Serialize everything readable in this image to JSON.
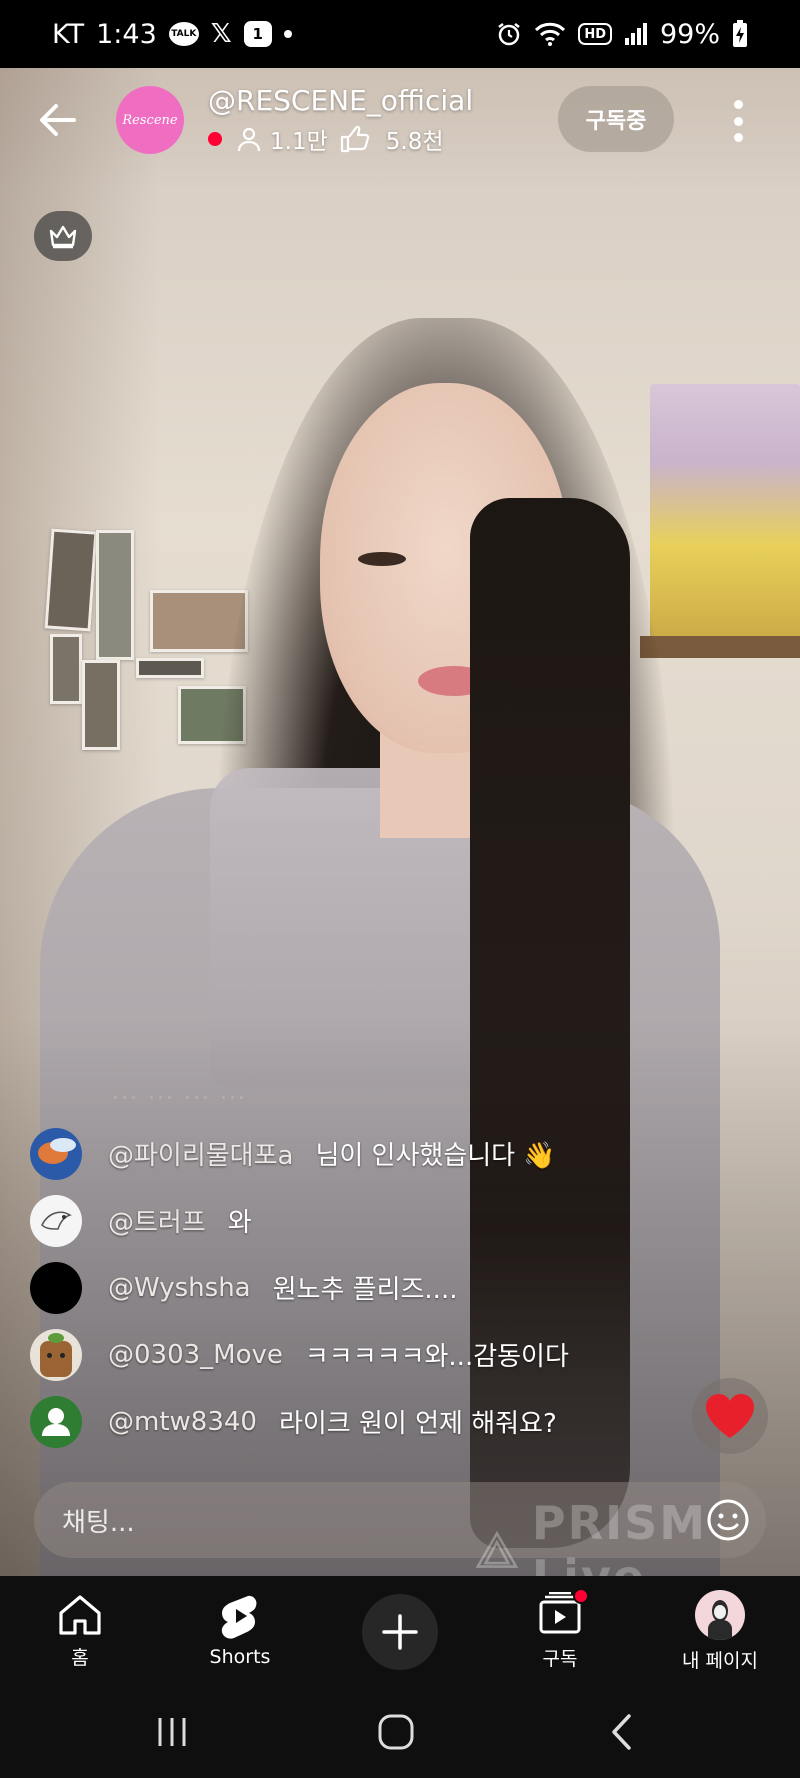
{
  "status_bar": {
    "carrier": "KT",
    "time": "1:43",
    "notif_talk": "TALK",
    "notif_x": "𝕏",
    "notif_one": "1",
    "wifi": "wifi-icon",
    "hd": "HD",
    "battery": "99%"
  },
  "header": {
    "channel_avatar_text": "Rescene",
    "channel_name": "@RESCENE_official",
    "viewers": "1.1만",
    "likes": "5.8천",
    "subscribe_label": "구독중"
  },
  "chat": {
    "faded_line": "... ... ... ...",
    "messages": [
      {
        "user": "@파이리물대포a",
        "text": "님이 인사했습니다 👋",
        "avatar_color": "#2b5aa8"
      },
      {
        "user": "@트러프",
        "text": "와",
        "avatar_color": "#f5f5f5"
      },
      {
        "user": "@Wyshsha",
        "text": "원노추 플리즈....",
        "avatar_color": "#000000"
      },
      {
        "user": "@0303_Move",
        "text": "ㅋㅋㅋㅋㅋ와...감동이다",
        "avatar_color": "#8b5a2b"
      },
      {
        "user": "@mtw8340",
        "text": "라이크 원이 언제 해줘요?",
        "avatar_color": "#2e7d32"
      }
    ],
    "input_placeholder": "채팅...",
    "watermark": "PRISM Live"
  },
  "bottom_nav": {
    "home_label": "홈",
    "shorts_label": "Shorts",
    "subscriptions_label": "구독",
    "mypage_label": "내 페이지"
  },
  "colors": {
    "live_red": "#ff0033",
    "heart_red": "#e8202c",
    "avatar_pink": "#f06ec2",
    "nav_bg": "#0f0f0f"
  }
}
